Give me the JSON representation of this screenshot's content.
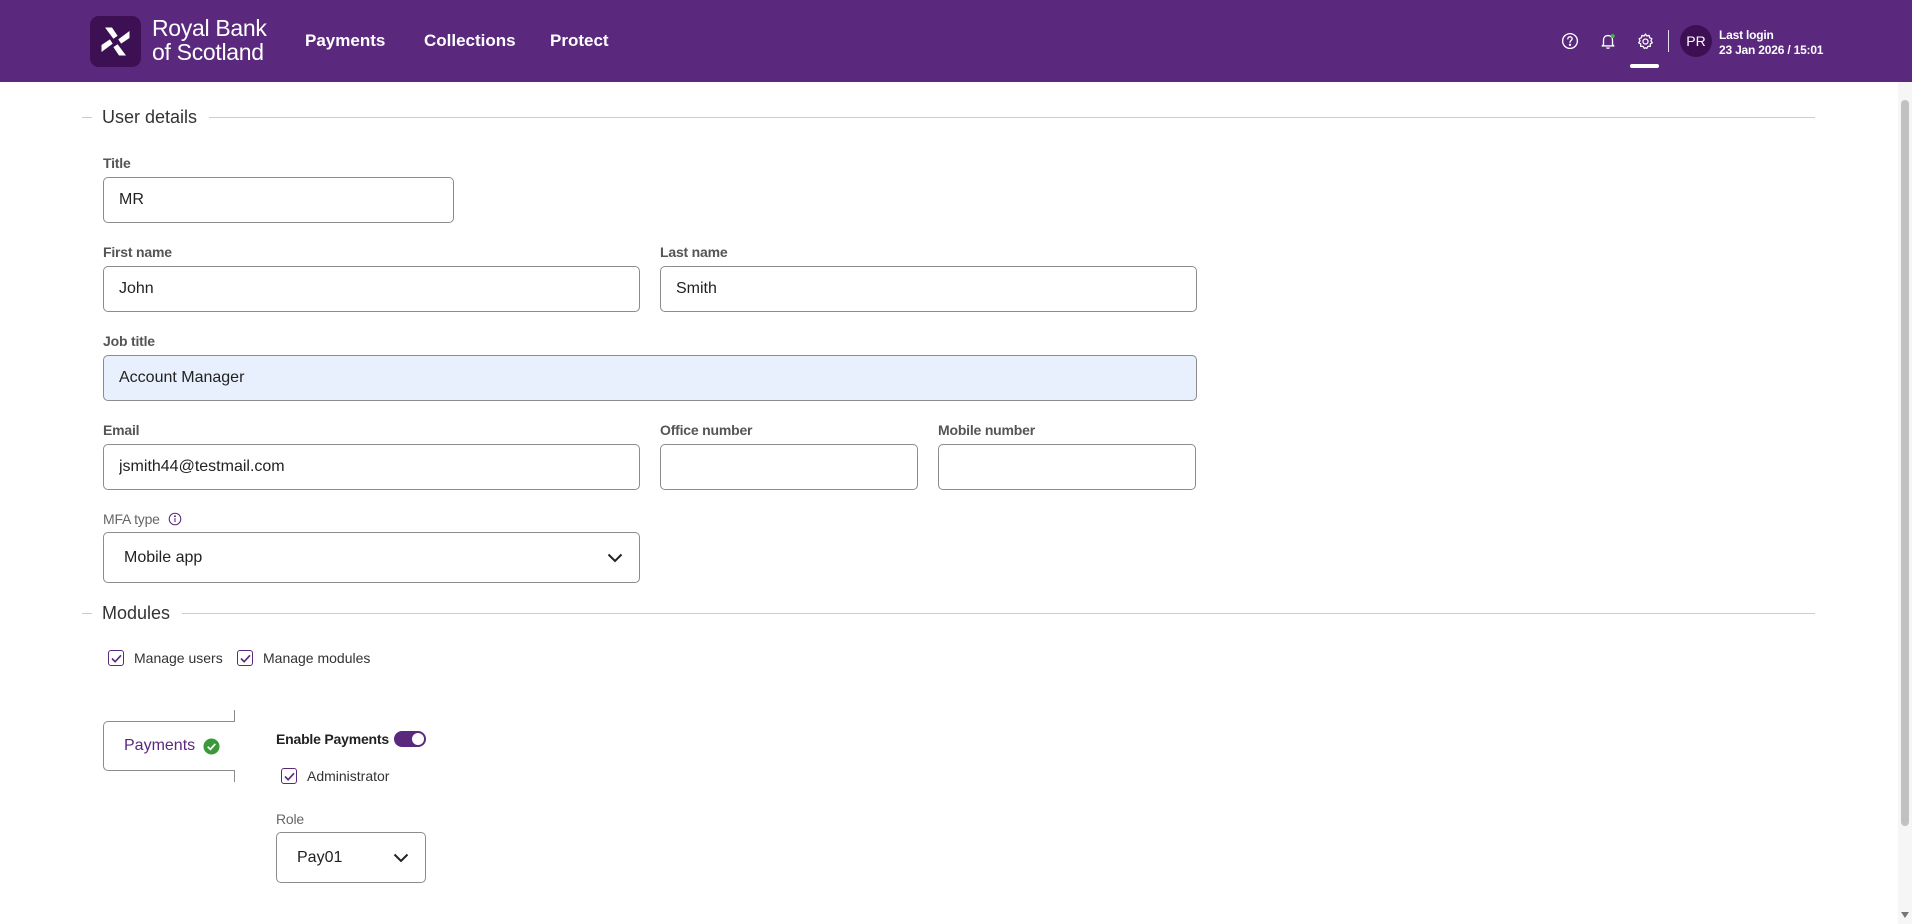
{
  "header": {
    "brand_line1": "Royal Bank",
    "brand_line2": "of Scotland",
    "nav": [
      {
        "label": "Payments"
      },
      {
        "label": "Collections"
      },
      {
        "label": "Protect"
      }
    ],
    "icons": [
      "help-icon",
      "bell-icon",
      "gear-icon"
    ],
    "avatar_initials": "PR",
    "last_login_label": "Last login",
    "last_login_value": "23 Jan 2026 / 15:01"
  },
  "user_details": {
    "section_title": "User details",
    "title_label": "Title",
    "title_value": "MR",
    "first_name_label": "First name",
    "first_name_value": "John",
    "last_name_label": "Last name",
    "last_name_value": "Smith",
    "job_title_label": "Job title",
    "job_title_value": "Account Manager",
    "email_label": "Email",
    "email_value": "jsmith44@testmail.com",
    "office_label": "Office number",
    "office_value": "",
    "mobile_label": "Mobile number",
    "mobile_value": "",
    "mfa_label": "MFA type",
    "mfa_value": "Mobile app"
  },
  "modules": {
    "section_title": "Modules",
    "checks": [
      {
        "label": "Manage users",
        "checked": true
      },
      {
        "label": "Manage modules",
        "checked": true
      }
    ],
    "tab_label": "Payments",
    "enable_label": "Enable Payments",
    "enable_on": true,
    "admin_label": "Administrator",
    "admin_checked": true,
    "role_label": "Role",
    "role_value": "Pay01"
  },
  "colors": {
    "brand_purple": "#5a287d",
    "dark_purple": "#3c1053",
    "success_green": "#3a9a3a",
    "focus_bg": "#e8f0fe"
  }
}
